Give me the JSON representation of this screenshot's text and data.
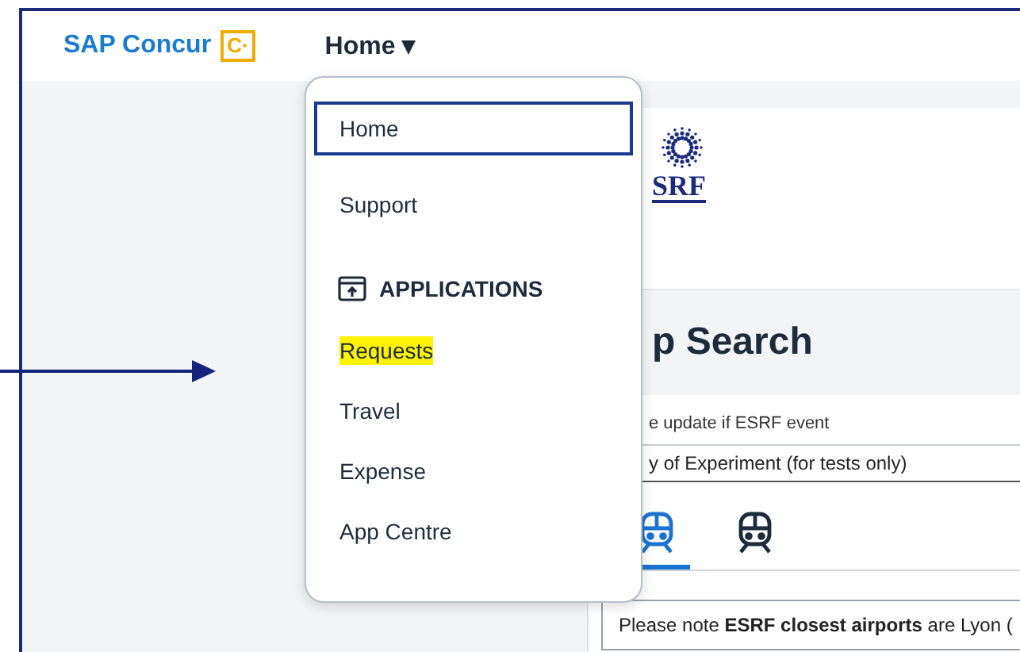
{
  "header": {
    "brand": "SAP Concur",
    "brand_mark": "C·",
    "nav": "Home ▾"
  },
  "menu": {
    "items": [
      {
        "kind": "link",
        "label": "Home",
        "selected": true,
        "highlighted": false
      },
      {
        "kind": "link",
        "label": "Support",
        "selected": false,
        "highlighted": false
      },
      {
        "kind": "section",
        "label": "APPLICATIONS"
      },
      {
        "kind": "link",
        "label": "Requests",
        "selected": false,
        "highlighted": true
      },
      {
        "kind": "link",
        "label": "Travel",
        "selected": false,
        "highlighted": false
      },
      {
        "kind": "link",
        "label": "Expense",
        "selected": false,
        "highlighted": false
      },
      {
        "kind": "link",
        "label": "App Centre",
        "selected": false,
        "highlighted": false
      }
    ]
  },
  "content": {
    "logo_text": "SRF",
    "heading": "p Search",
    "hint": "e update if ESRF event",
    "field_value": "y of Experiment (for tests only)",
    "modes": [
      {
        "selected": true
      },
      {
        "selected": false
      }
    ],
    "notice": "Please note **ESRF closest airports** are Lyon ("
  }
}
